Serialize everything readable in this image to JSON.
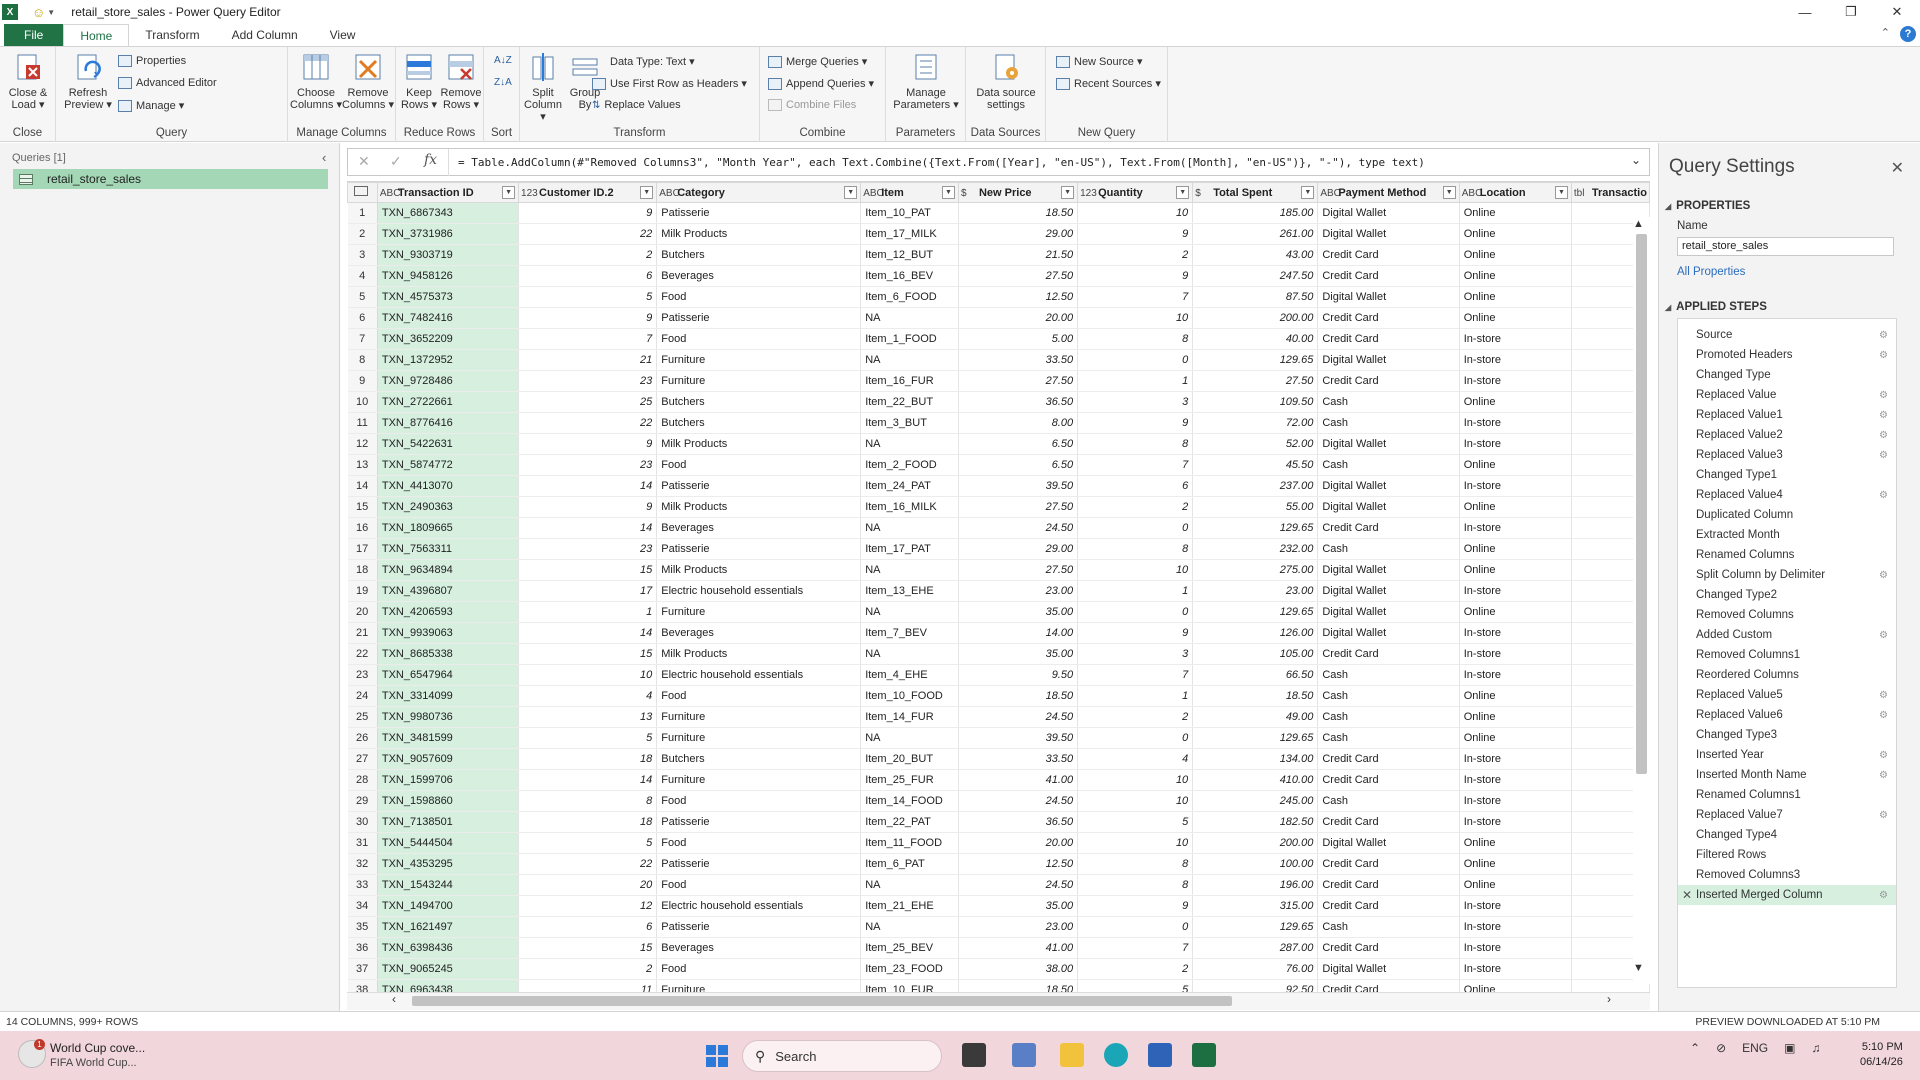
{
  "window": {
    "title": "retail_store_sales - Power Query Editor"
  },
  "menu_tabs": [
    "File",
    "Home",
    "Transform",
    "Add Column",
    "View"
  ],
  "ribbon": {
    "close": {
      "close_load": [
        "Close &",
        "Load ▾"
      ],
      "group": "Close"
    },
    "query": {
      "refresh": [
        "Refresh",
        "Preview ▾"
      ],
      "properties": "Properties",
      "advanced_editor": "Advanced Editor",
      "manage": "Manage ▾",
      "group": "Query"
    },
    "manage_columns": {
      "choose": [
        "Choose",
        "Columns ▾"
      ],
      "remove": [
        "Remove",
        "Columns ▾"
      ],
      "group": "Manage Columns"
    },
    "reduce_rows": {
      "keep": [
        "Keep",
        "Rows ▾"
      ],
      "remove": [
        "Remove",
        "Rows ▾"
      ],
      "group": "Reduce Rows"
    },
    "sort": {
      "group": "Sort"
    },
    "transform": {
      "split": [
        "Split",
        "Column ▾"
      ],
      "group_by": [
        "Group",
        "By"
      ],
      "data_type": "Data Type: Text ▾",
      "first_row": "Use First Row as Headers ▾",
      "replace": "Replace Values",
      "group": "Transform"
    },
    "combine": {
      "merge": "Merge Queries ▾",
      "append": "Append Queries ▾",
      "combine_files": "Combine Files",
      "group": "Combine"
    },
    "parameters": {
      "manage": [
        "Manage",
        "Parameters ▾"
      ],
      "group": "Parameters"
    },
    "data_sources": {
      "settings": [
        "Data source",
        "settings"
      ],
      "group": "Data Sources"
    },
    "new_query": {
      "new_source": "New Source ▾",
      "recent": "Recent Sources ▾",
      "group": "New Query"
    }
  },
  "queries_pane": {
    "label": "Queries [1]",
    "items": [
      "retail_store_sales"
    ]
  },
  "formula": "= Table.AddColumn(#\"Removed Columns3\", \"Month Year\", each Text.Combine({Text.From([Year], \"en-US\"), Text.From([Month], \"en-US\")}, \"-\"), type text)",
  "columns": [
    {
      "name": "Transaction ID",
      "type": "ABC"
    },
    {
      "name": "Customer ID.2",
      "type": "123"
    },
    {
      "name": "Category",
      "type": "ABC"
    },
    {
      "name": "Item",
      "type": "ABC"
    },
    {
      "name": "New Price",
      "type": "$"
    },
    {
      "name": "Quantity",
      "type": "123"
    },
    {
      "name": "Total Spent",
      "type": "$"
    },
    {
      "name": "Payment Method",
      "type": "ABC"
    },
    {
      "name": "Location",
      "type": "ABC"
    },
    {
      "name": "Transactio",
      "type": "tbl"
    }
  ],
  "rows": [
    [
      "TXN_6867343",
      "9",
      "Patisserie",
      "Item_10_PAT",
      "18.50",
      "10",
      "185.00",
      "Digital Wallet",
      "Online"
    ],
    [
      "TXN_3731986",
      "22",
      "Milk Products",
      "Item_17_MILK",
      "29.00",
      "9",
      "261.00",
      "Digital Wallet",
      "Online"
    ],
    [
      "TXN_9303719",
      "2",
      "Butchers",
      "Item_12_BUT",
      "21.50",
      "2",
      "43.00",
      "Credit Card",
      "Online"
    ],
    [
      "TXN_9458126",
      "6",
      "Beverages",
      "Item_16_BEV",
      "27.50",
      "9",
      "247.50",
      "Credit Card",
      "Online"
    ],
    [
      "TXN_4575373",
      "5",
      "Food",
      "Item_6_FOOD",
      "12.50",
      "7",
      "87.50",
      "Digital Wallet",
      "Online"
    ],
    [
      "TXN_7482416",
      "9",
      "Patisserie",
      "NA",
      "20.00",
      "10",
      "200.00",
      "Credit Card",
      "Online"
    ],
    [
      "TXN_3652209",
      "7",
      "Food",
      "Item_1_FOOD",
      "5.00",
      "8",
      "40.00",
      "Credit Card",
      "In-store"
    ],
    [
      "TXN_1372952",
      "21",
      "Furniture",
      "NA",
      "33.50",
      "0",
      "129.65",
      "Digital Wallet",
      "In-store"
    ],
    [
      "TXN_9728486",
      "23",
      "Furniture",
      "Item_16_FUR",
      "27.50",
      "1",
      "27.50",
      "Credit Card",
      "In-store"
    ],
    [
      "TXN_2722661",
      "25",
      "Butchers",
      "Item_22_BUT",
      "36.50",
      "3",
      "109.50",
      "Cash",
      "Online"
    ],
    [
      "TXN_8776416",
      "22",
      "Butchers",
      "Item_3_BUT",
      "8.00",
      "9",
      "72.00",
      "Cash",
      "In-store"
    ],
    [
      "TXN_5422631",
      "9",
      "Milk Products",
      "NA",
      "6.50",
      "8",
      "52.00",
      "Digital Wallet",
      "In-store"
    ],
    [
      "TXN_5874772",
      "23",
      "Food",
      "Item_2_FOOD",
      "6.50",
      "7",
      "45.50",
      "Cash",
      "Online"
    ],
    [
      "TXN_4413070",
      "14",
      "Patisserie",
      "Item_24_PAT",
      "39.50",
      "6",
      "237.00",
      "Digital Wallet",
      "In-store"
    ],
    [
      "TXN_2490363",
      "9",
      "Milk Products",
      "Item_16_MILK",
      "27.50",
      "2",
      "55.00",
      "Digital Wallet",
      "Online"
    ],
    [
      "TXN_1809665",
      "14",
      "Beverages",
      "NA",
      "24.50",
      "0",
      "129.65",
      "Credit Card",
      "In-store"
    ],
    [
      "TXN_7563311",
      "23",
      "Patisserie",
      "Item_17_PAT",
      "29.00",
      "8",
      "232.00",
      "Cash",
      "Online"
    ],
    [
      "TXN_9634894",
      "15",
      "Milk Products",
      "NA",
      "27.50",
      "10",
      "275.00",
      "Digital Wallet",
      "Online"
    ],
    [
      "TXN_4396807",
      "17",
      "Electric household essentials",
      "Item_13_EHE",
      "23.00",
      "1",
      "23.00",
      "Digital Wallet",
      "In-store"
    ],
    [
      "TXN_4206593",
      "1",
      "Furniture",
      "NA",
      "35.00",
      "0",
      "129.65",
      "Digital Wallet",
      "Online"
    ],
    [
      "TXN_9939063",
      "14",
      "Beverages",
      "Item_7_BEV",
      "14.00",
      "9",
      "126.00",
      "Digital Wallet",
      "In-store"
    ],
    [
      "TXN_8685338",
      "15",
      "Milk Products",
      "NA",
      "35.00",
      "3",
      "105.00",
      "Credit Card",
      "In-store"
    ],
    [
      "TXN_6547964",
      "10",
      "Electric household essentials",
      "Item_4_EHE",
      "9.50",
      "7",
      "66.50",
      "Cash",
      "In-store"
    ],
    [
      "TXN_3314099",
      "4",
      "Food",
      "Item_10_FOOD",
      "18.50",
      "1",
      "18.50",
      "Cash",
      "Online"
    ],
    [
      "TXN_9980736",
      "13",
      "Furniture",
      "Item_14_FUR",
      "24.50",
      "2",
      "49.00",
      "Cash",
      "Online"
    ],
    [
      "TXN_3481599",
      "5",
      "Furniture",
      "NA",
      "39.50",
      "0",
      "129.65",
      "Cash",
      "Online"
    ],
    [
      "TXN_9057609",
      "18",
      "Butchers",
      "Item_20_BUT",
      "33.50",
      "4",
      "134.00",
      "Credit Card",
      "In-store"
    ],
    [
      "TXN_1599706",
      "14",
      "Furniture",
      "Item_25_FUR",
      "41.00",
      "10",
      "410.00",
      "Credit Card",
      "In-store"
    ],
    [
      "TXN_1598860",
      "8",
      "Food",
      "Item_14_FOOD",
      "24.50",
      "10",
      "245.00",
      "Cash",
      "In-store"
    ],
    [
      "TXN_7138501",
      "18",
      "Patisserie",
      "Item_22_PAT",
      "36.50",
      "5",
      "182.50",
      "Credit Card",
      "In-store"
    ],
    [
      "TXN_5444504",
      "5",
      "Food",
      "Item_11_FOOD",
      "20.00",
      "10",
      "200.00",
      "Digital Wallet",
      "Online"
    ],
    [
      "TXN_4353295",
      "22",
      "Patisserie",
      "Item_6_PAT",
      "12.50",
      "8",
      "100.00",
      "Credit Card",
      "Online"
    ],
    [
      "TXN_1543244",
      "20",
      "Food",
      "NA",
      "24.50",
      "8",
      "196.00",
      "Credit Card",
      "Online"
    ],
    [
      "TXN_1494700",
      "12",
      "Electric household essentials",
      "Item_21_EHE",
      "35.00",
      "9",
      "315.00",
      "Credit Card",
      "In-store"
    ],
    [
      "TXN_1621497",
      "6",
      "Patisserie",
      "NA",
      "23.00",
      "0",
      "129.65",
      "Cash",
      "In-store"
    ],
    [
      "TXN_6398436",
      "15",
      "Beverages",
      "Item_25_BEV",
      "41.00",
      "7",
      "287.00",
      "Credit Card",
      "In-store"
    ],
    [
      "TXN_9065245",
      "2",
      "Food",
      "Item_23_FOOD",
      "38.00",
      "2",
      "76.00",
      "Digital Wallet",
      "In-store"
    ],
    [
      "TXN_6963438",
      "11",
      "Furniture",
      "Item_10_FUR",
      "18.50",
      "5",
      "92.50",
      "Credit Card",
      "Online"
    ]
  ],
  "query_settings": {
    "title": "Query Settings",
    "properties_header": "PROPERTIES",
    "name_label": "Name",
    "name_value": "retail_store_sales",
    "all_properties": "All Properties",
    "steps_header": "APPLIED STEPS",
    "steps": [
      {
        "name": "Source",
        "gear": true
      },
      {
        "name": "Promoted Headers",
        "gear": true
      },
      {
        "name": "Changed Type",
        "gear": false
      },
      {
        "name": "Replaced Value",
        "gear": true
      },
      {
        "name": "Replaced Value1",
        "gear": true
      },
      {
        "name": "Replaced Value2",
        "gear": true
      },
      {
        "name": "Replaced Value3",
        "gear": true
      },
      {
        "name": "Changed Type1",
        "gear": false
      },
      {
        "name": "Replaced Value4",
        "gear": true
      },
      {
        "name": "Duplicated Column",
        "gear": false
      },
      {
        "name": "Extracted Month",
        "gear": false
      },
      {
        "name": "Renamed Columns",
        "gear": false
      },
      {
        "name": "Split Column by Delimiter",
        "gear": true
      },
      {
        "name": "Changed Type2",
        "gear": false
      },
      {
        "name": "Removed Columns",
        "gear": false
      },
      {
        "name": "Added Custom",
        "gear": true
      },
      {
        "name": "Removed Columns1",
        "gear": false
      },
      {
        "name": "Reordered Columns",
        "gear": false
      },
      {
        "name": "Replaced Value5",
        "gear": true
      },
      {
        "name": "Replaced Value6",
        "gear": true
      },
      {
        "name": "Changed Type3",
        "gear": false
      },
      {
        "name": "Inserted Year",
        "gear": true
      },
      {
        "name": "Inserted Month Name",
        "gear": true
      },
      {
        "name": "Renamed Columns1",
        "gear": false
      },
      {
        "name": "Replaced Value7",
        "gear": true
      },
      {
        "name": "Changed Type4",
        "gear": false
      },
      {
        "name": "Filtered Rows",
        "gear": false
      },
      {
        "name": "Removed Columns3",
        "gear": false
      },
      {
        "name": "Inserted Merged Column",
        "gear": true,
        "active": true
      }
    ]
  },
  "status": {
    "left": "14 COLUMNS, 999+ ROWS",
    "right": "PREVIEW DOWNLOADED AT 5:10 PM"
  },
  "taskbar": {
    "news_title": "World Cup cove...",
    "news_sub": "FIFA World Cup...",
    "search": "Search",
    "lang": "ENG",
    "time": "5:10 PM",
    "date": "06/14/26"
  },
  "colors": {
    "accent": "#217346",
    "selected_col": "#d6efdf",
    "query_highlight": "#a4d7b6",
    "taskbar": "#f1d6dc"
  }
}
